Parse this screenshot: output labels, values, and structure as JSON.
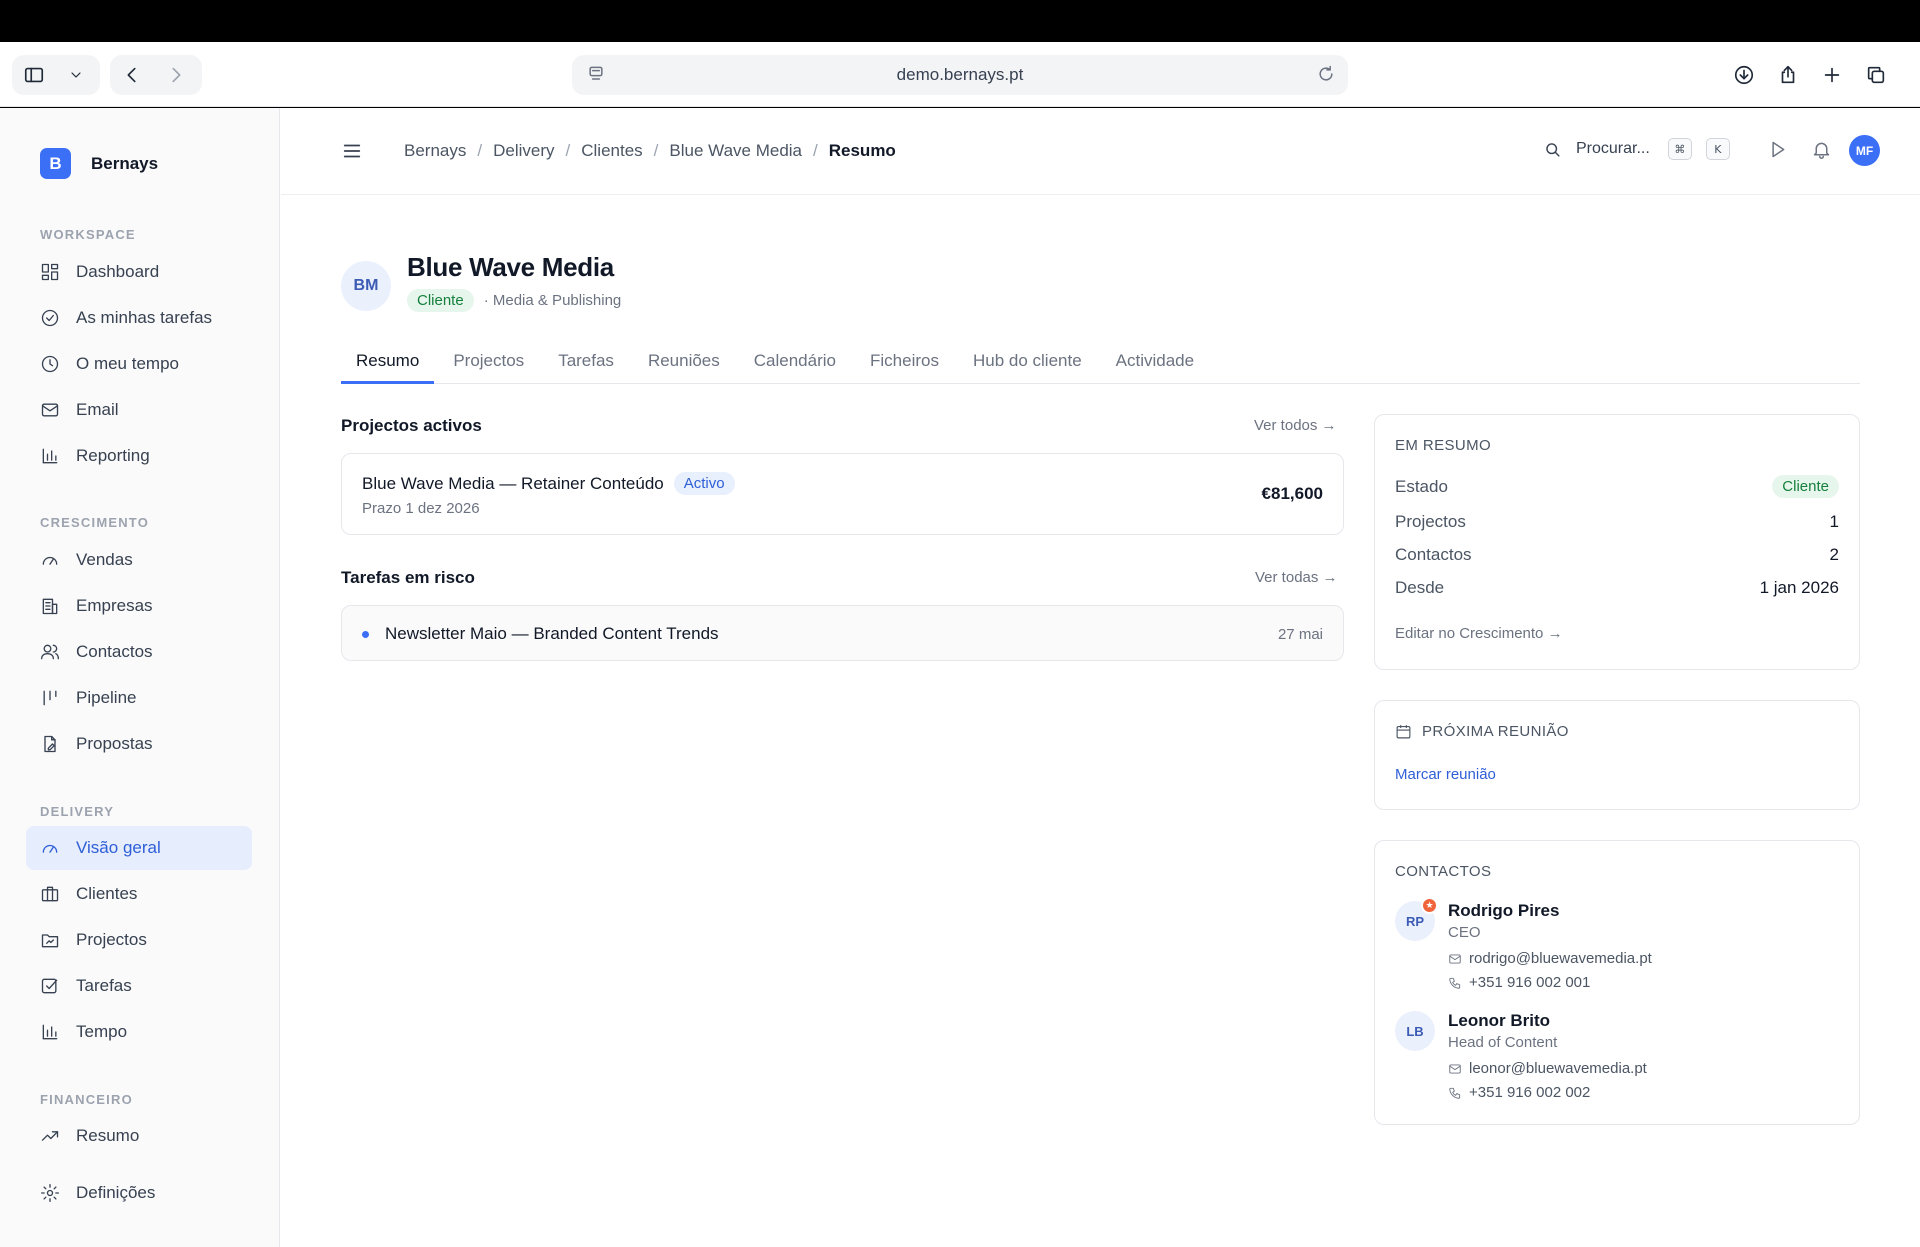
{
  "browser": {
    "url": "demo.bernays.pt",
    "icons": [
      "sidebar-icon",
      "chevron-down-icon",
      "back-icon",
      "forward-icon",
      "page-icon",
      "reload-icon",
      "download-icon",
      "share-icon",
      "plus-icon",
      "tabs-icon"
    ]
  },
  "sidebar": {
    "brand_logo": "B",
    "brand_name": "Bernays",
    "sections": {
      "workspace": "WORKSPACE",
      "crescimento": "CRESCIMENTO",
      "delivery": "DELIVERY",
      "financeiro": "FINANCEIRO"
    },
    "items": {
      "dashboard": "Dashboard",
      "tarefas_minhas": "As minhas tarefas",
      "tempo_meu": "O meu tempo",
      "email": "Email",
      "reporting": "Reporting",
      "vendas": "Vendas",
      "empresas": "Empresas",
      "contactos": "Contactos",
      "pipeline": "Pipeline",
      "propostas": "Propostas",
      "visao_geral": "Visão geral",
      "clientes": "Clientes",
      "projectos": "Projectos",
      "tarefas": "Tarefas",
      "tempo": "Tempo",
      "resumo": "Resumo",
      "definicoes": "Definições"
    }
  },
  "topbar": {
    "breadcrumb": [
      "Bernays",
      "Delivery",
      "Clientes",
      "Blue Wave Media",
      "Resumo"
    ],
    "separator": "/",
    "search_placeholder": "Procurar...",
    "kbd_cmd": "⌘",
    "kbd_k": "K",
    "avatar": "MF"
  },
  "client": {
    "initials": "BM",
    "name": "Blue Wave Media",
    "status": "Cliente",
    "industry": "· Media & Publishing"
  },
  "tabs": [
    "Resumo",
    "Projectos",
    "Tarefas",
    "Reuniões",
    "Calendário",
    "Ficheiros",
    "Hub do cliente",
    "Actividade"
  ],
  "projects": {
    "title": "Projectos activos",
    "see_all": "Ver todos →",
    "item": {
      "name": "Blue Wave Media — Retainer Conteúdo",
      "status": "Activo",
      "deadline": "Prazo 1 dez 2026",
      "amount": "€81,600"
    }
  },
  "risk_tasks": {
    "title": "Tarefas em risco",
    "see_all": "Ver todas →",
    "item": {
      "name": "Newsletter Maio — Branded Content Trends",
      "date": "27 mai"
    }
  },
  "summary": {
    "title": "EM RESUMO",
    "rows": [
      {
        "label": "Estado",
        "value": "Cliente"
      },
      {
        "label": "Projectos",
        "value": "1"
      },
      {
        "label": "Contactos",
        "value": "2"
      },
      {
        "label": "Desde",
        "value": "1 jan 2026"
      }
    ],
    "edit_link": "Editar no Crescimento →"
  },
  "next_meeting": {
    "title": "PRÓXIMA REUNIÃO",
    "link": "Marcar reunião"
  },
  "contacts": {
    "title": "CONTACTOS",
    "people": [
      {
        "initials": "RP",
        "name": "Rodrigo Pires",
        "role": "CEO",
        "email": "rodrigo@bluewavemedia.pt",
        "phone": "+351 916 002 001",
        "primary": true
      },
      {
        "initials": "LB",
        "name": "Leonor Brito",
        "role": "Head of Content",
        "email": "leonor@bluewavemedia.pt",
        "phone": "+351 916 002 002",
        "primary": false
      }
    ]
  },
  "colors": {
    "accent": "#3b6ff5",
    "active_bg": "#e6edfd",
    "success_bg": "#e7f6ec",
    "success_text": "#15803d",
    "primary_star": "#f0643c"
  }
}
